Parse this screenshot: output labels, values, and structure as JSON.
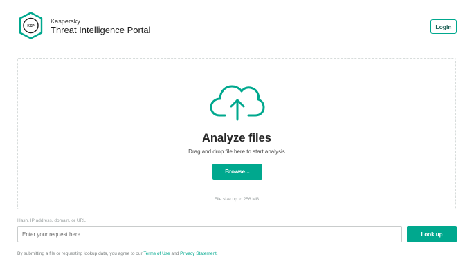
{
  "header": {
    "logo_icon": "kaspersky-shield-icon",
    "logo_text": "KASPERSKY",
    "brand_small": "Kaspersky",
    "brand_title": "Threat Intelligence Portal",
    "login_label": "Login"
  },
  "dropzone": {
    "icon": "cloud-upload-icon",
    "title": "Analyze files",
    "subtitle": "Drag and drop file here to start analysis",
    "browse_label": "Browse...",
    "size_note": "File size up to 256 MB"
  },
  "lookup": {
    "label": "Hash, IP address, domain, or URL",
    "placeholder": "Enter your request here",
    "value": "",
    "button_label": "Look up"
  },
  "disclaimer": {
    "prefix": "By submitting a file or requesting lookup data, you agree to our ",
    "terms_link": "Terms of Use",
    "and": " and ",
    "privacy_link": "Privacy Statement",
    "suffix": "."
  },
  "colors": {
    "accent": "#00a88e",
    "dark_text": "#262626",
    "muted_text": "#9aa0a0",
    "border": "#d7dcdb"
  }
}
